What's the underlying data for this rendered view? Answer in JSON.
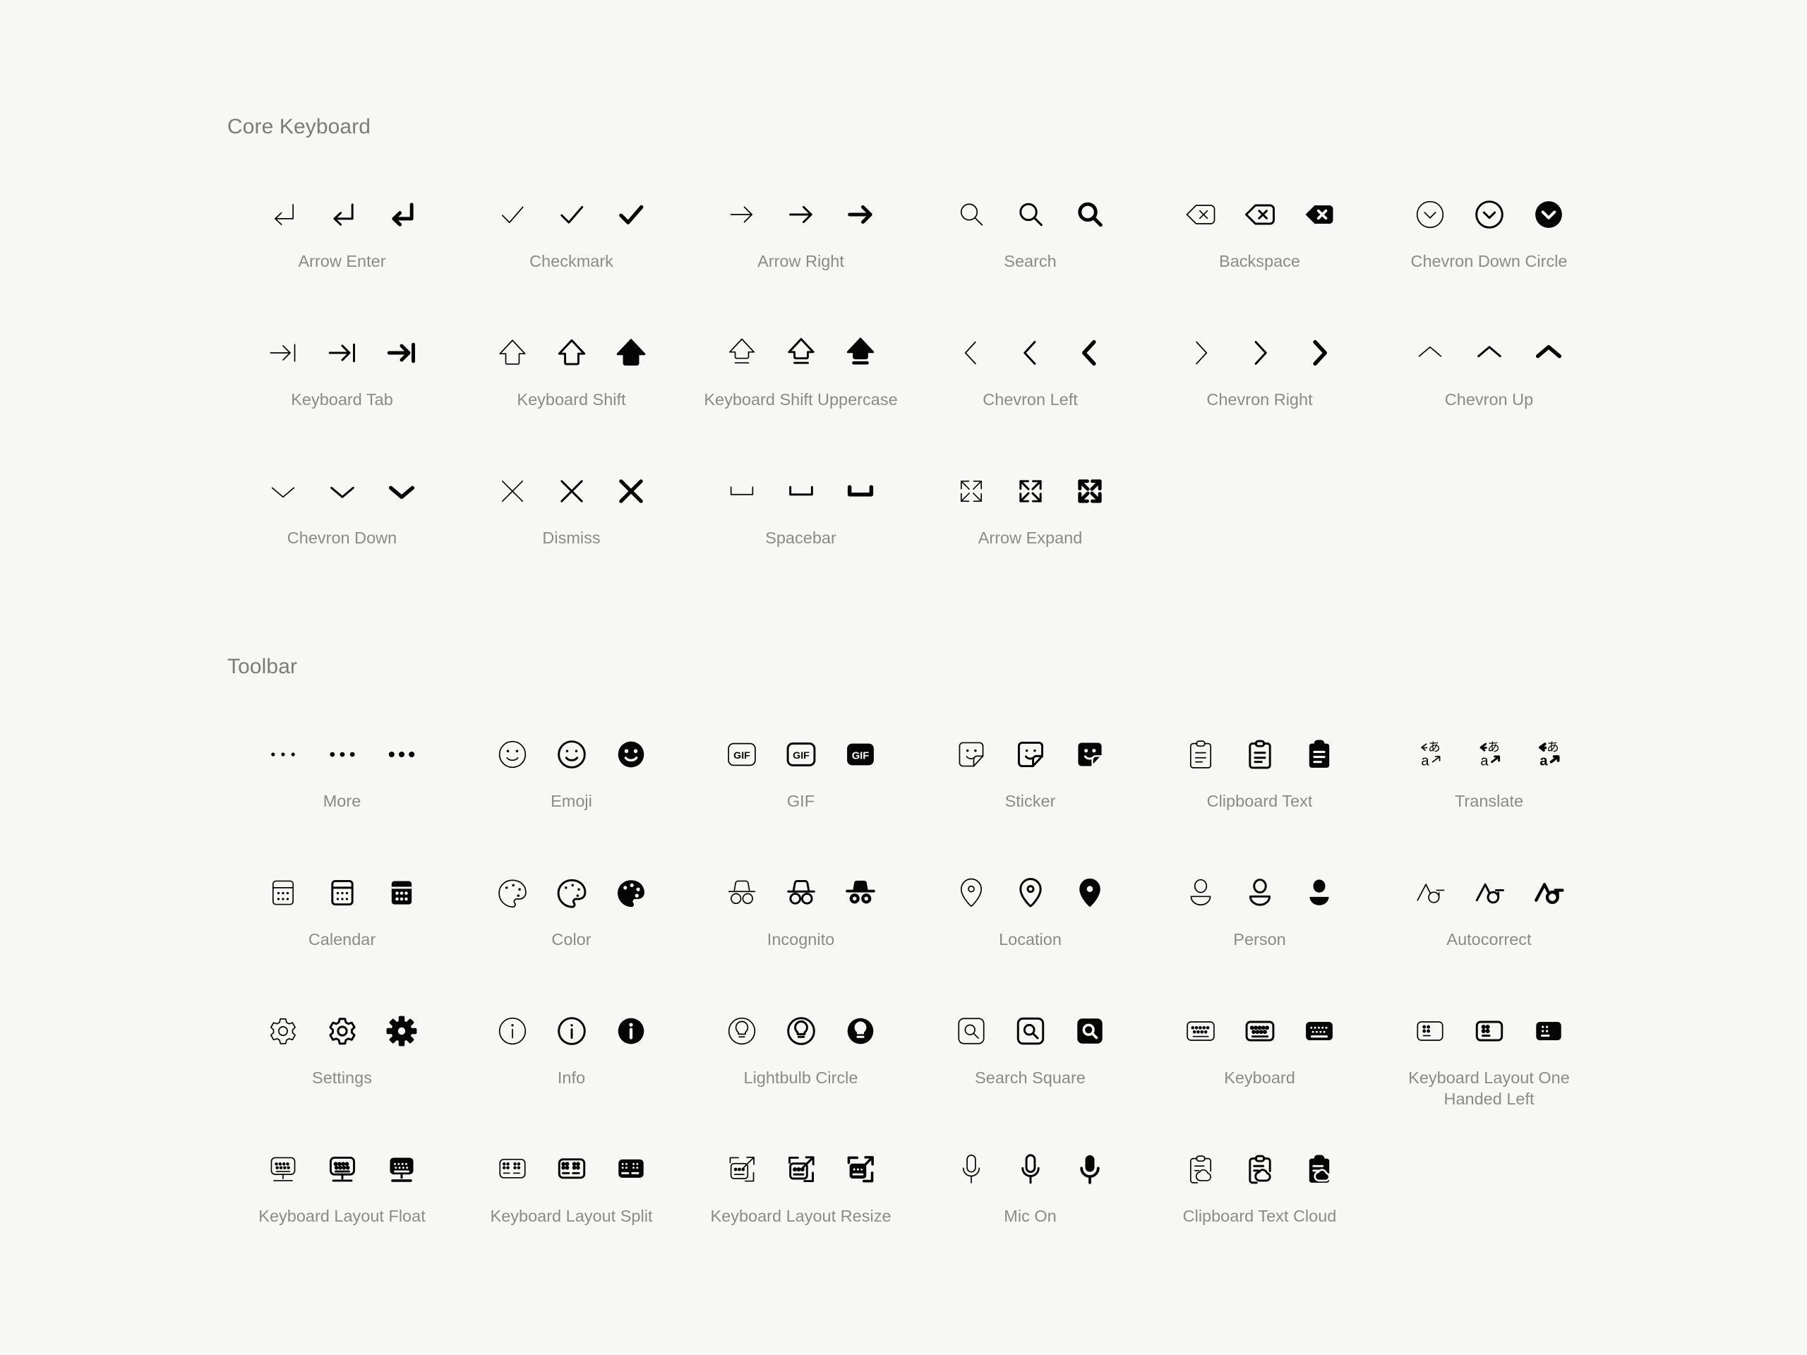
{
  "page": {
    "background_color": "#f7f7f6",
    "icon_color": "#050505",
    "label_color": "#8a8a8a",
    "section_title_color": "#7b7b7b",
    "weights": [
      "light",
      "regular",
      "filled"
    ]
  },
  "sections": [
    {
      "title": "Core Keyboard",
      "rows": [
        [
          {
            "label": "Arrow Enter",
            "icon": "arrow-enter-icon"
          },
          {
            "label": "Checkmark",
            "icon": "checkmark-icon"
          },
          {
            "label": "Arrow Right",
            "icon": "arrow-right-icon"
          },
          {
            "label": "Search",
            "icon": "search-icon"
          },
          {
            "label": "Backspace",
            "icon": "backspace-icon"
          },
          {
            "label": "Chevron Down Circle",
            "icon": "chevron-down-circle-icon"
          }
        ],
        [
          {
            "label": "Keyboard Tab",
            "icon": "keyboard-tab-icon"
          },
          {
            "label": "Keyboard Shift",
            "icon": "keyboard-shift-icon"
          },
          {
            "label": "Keyboard Shift Uppercase",
            "icon": "keyboard-shift-uppercase-icon"
          },
          {
            "label": "Chevron Left",
            "icon": "chevron-left-icon"
          },
          {
            "label": "Chevron Right",
            "icon": "chevron-right-icon"
          },
          {
            "label": "Chevron Up",
            "icon": "chevron-up-icon"
          }
        ],
        [
          {
            "label": "Chevron Down",
            "icon": "chevron-down-icon"
          },
          {
            "label": "Dismiss",
            "icon": "dismiss-icon"
          },
          {
            "label": "Spacebar",
            "icon": "spacebar-icon"
          },
          {
            "label": "Arrow Expand",
            "icon": "arrow-expand-icon"
          },
          {
            "label": "",
            "icon": ""
          },
          {
            "label": "",
            "icon": ""
          }
        ]
      ]
    },
    {
      "title": "Toolbar",
      "rows": [
        [
          {
            "label": "More",
            "icon": "more-icon"
          },
          {
            "label": "Emoji",
            "icon": "emoji-icon"
          },
          {
            "label": "GIF",
            "icon": "gif-icon"
          },
          {
            "label": "Sticker",
            "icon": "sticker-icon"
          },
          {
            "label": "Clipboard Text",
            "icon": "clipboard-text-icon"
          },
          {
            "label": "Translate",
            "icon": "translate-icon"
          }
        ],
        [
          {
            "label": "Calendar",
            "icon": "calendar-icon"
          },
          {
            "label": "Color",
            "icon": "color-icon"
          },
          {
            "label": "Incognito",
            "icon": "incognito-icon"
          },
          {
            "label": "Location",
            "icon": "location-icon"
          },
          {
            "label": "Person",
            "icon": "person-icon"
          },
          {
            "label": "Autocorrect",
            "icon": "autocorrect-icon"
          }
        ],
        [
          {
            "label": "Settings",
            "icon": "settings-icon"
          },
          {
            "label": "Info",
            "icon": "info-icon"
          },
          {
            "label": "Lightbulb Circle",
            "icon": "lightbulb-circle-icon"
          },
          {
            "label": "Search Square",
            "icon": "search-square-icon"
          },
          {
            "label": "Keyboard",
            "icon": "keyboard-icon"
          },
          {
            "label": "Keyboard Layout One Handed Left",
            "icon": "keyboard-layout-one-handed-left-icon"
          }
        ],
        [
          {
            "label": "Keyboard Layout Float",
            "icon": "keyboard-layout-float-icon"
          },
          {
            "label": "Keyboard Layout Split",
            "icon": "keyboard-layout-split-icon"
          },
          {
            "label": "Keyboard Layout Resize",
            "icon": "keyboard-layout-resize-icon"
          },
          {
            "label": "Mic On",
            "icon": "mic-on-icon"
          },
          {
            "label": "Clipboard Text Cloud",
            "icon": "clipboard-text-cloud-icon"
          },
          {
            "label": "",
            "icon": ""
          }
        ]
      ]
    }
  ]
}
